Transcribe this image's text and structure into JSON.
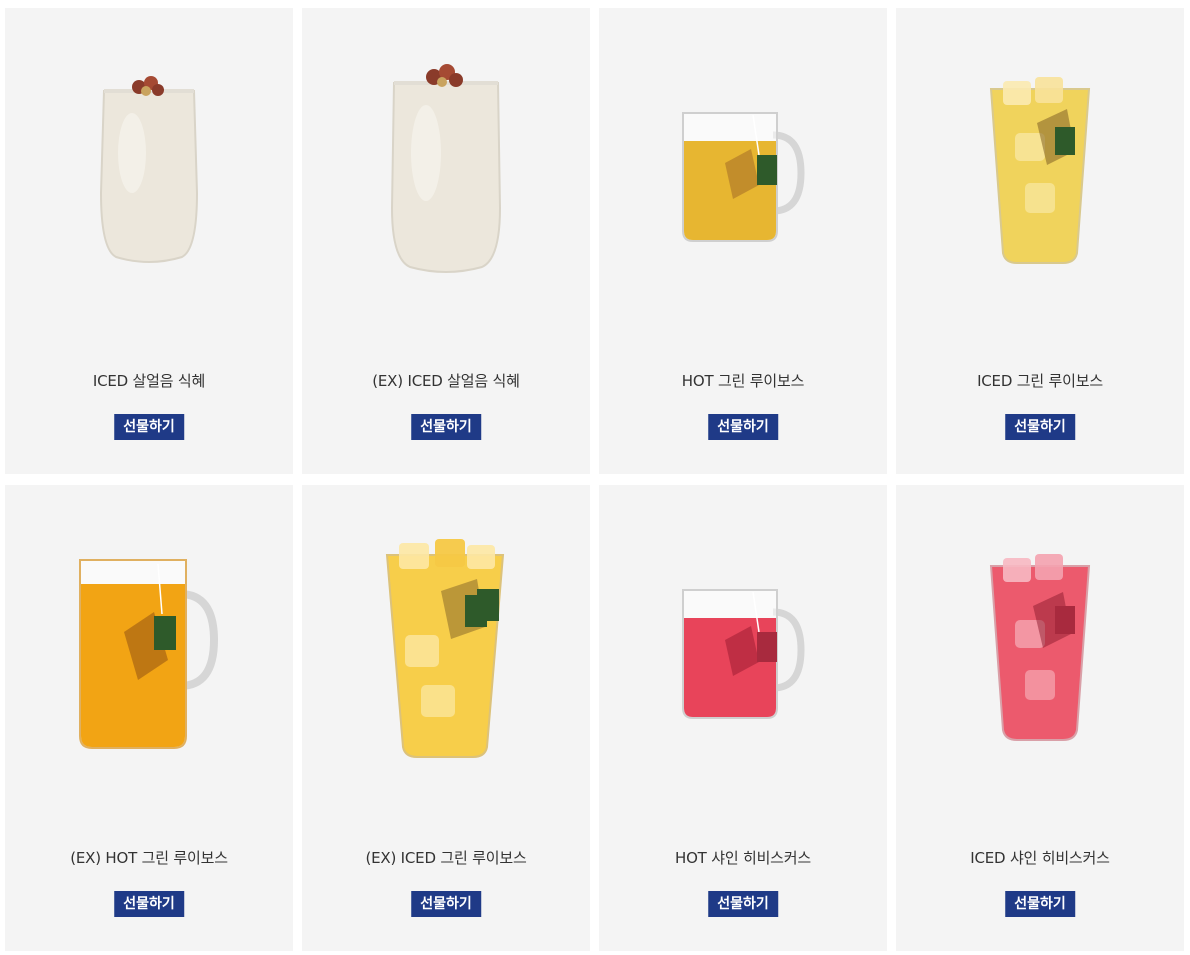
{
  "products": [
    {
      "name": "ICED 살얼음 식혜",
      "button": "선물하기",
      "drink": "sikhye-iced-glass-icon",
      "liquid": "#ece7dc"
    },
    {
      "name": "(EX) ICED 살얼음 식혜",
      "button": "선물하기",
      "drink": "sikhye-iced-glass-large-icon",
      "liquid": "#ece7dc"
    },
    {
      "name": "HOT 그린 루이보스",
      "button": "선물하기",
      "drink": "rooibos-hot-mug-icon",
      "liquid": "#e7b631"
    },
    {
      "name": "ICED 그린 루이보스",
      "button": "선물하기",
      "drink": "rooibos-iced-glass-icon",
      "liquid": "#f0d35c"
    },
    {
      "name": "(EX) HOT 그린 루이보스",
      "button": "선물하기",
      "drink": "rooibos-hot-mug-large-icon",
      "liquid": "#f2a414"
    },
    {
      "name": "(EX) ICED 그린 루이보스",
      "button": "선물하기",
      "drink": "rooibos-iced-glass-large-icon",
      "liquid": "#f7ce4a"
    },
    {
      "name": "HOT 샤인 히비스커스",
      "button": "선물하기",
      "drink": "hibiscus-hot-mug-icon",
      "liquid": "#e8445a"
    },
    {
      "name": "ICED 샤인 히비스커스",
      "button": "선물하기",
      "drink": "hibiscus-iced-glass-icon",
      "liquid": "#ec5a6d"
    }
  ]
}
